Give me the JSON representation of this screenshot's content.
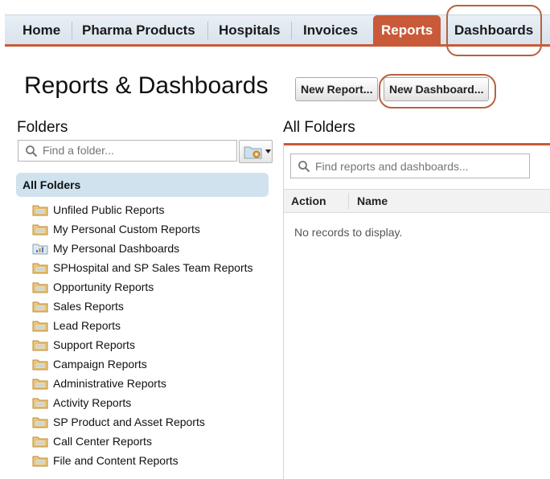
{
  "tabs": [
    {
      "label": "Home",
      "active": false
    },
    {
      "label": "Pharma Products",
      "active": false
    },
    {
      "label": "Hospitals",
      "active": false
    },
    {
      "label": "Invoices",
      "active": false
    },
    {
      "label": "Reports",
      "active": true
    },
    {
      "label": "Dashboards",
      "active": false,
      "circled": true
    }
  ],
  "page": {
    "title": "Reports & Dashboards",
    "new_report_button": "New Report...",
    "new_dashboard_button": "New Dashboard..."
  },
  "folders_panel": {
    "heading": "Folders",
    "search_placeholder": "Find a folder...",
    "search_value": "",
    "all_folders_label": "All Folders",
    "folders": [
      {
        "label": "Unfiled Public Reports",
        "icon": "report-folder-icon"
      },
      {
        "label": "My Personal Custom Reports",
        "icon": "report-folder-icon"
      },
      {
        "label": "My Personal Dashboards",
        "icon": "dashboard-folder-icon"
      },
      {
        "label": "SPHospital and SP Sales Team Reports",
        "icon": "report-folder-icon"
      },
      {
        "label": "Opportunity Reports",
        "icon": "report-folder-icon"
      },
      {
        "label": "Sales Reports",
        "icon": "report-folder-icon"
      },
      {
        "label": "Lead Reports",
        "icon": "report-folder-icon"
      },
      {
        "label": "Support Reports",
        "icon": "report-folder-icon"
      },
      {
        "label": "Campaign Reports",
        "icon": "report-folder-icon"
      },
      {
        "label": "Administrative Reports",
        "icon": "report-folder-icon"
      },
      {
        "label": "Activity Reports",
        "icon": "report-folder-icon"
      },
      {
        "label": "SP Product and Asset Reports",
        "icon": "report-folder-icon"
      },
      {
        "label": "Call Center Reports",
        "icon": "report-folder-icon"
      },
      {
        "label": "File and Content Reports",
        "icon": "report-folder-icon"
      }
    ]
  },
  "content_panel": {
    "heading": "All Folders",
    "search_placeholder": "Find reports and dashboards...",
    "search_value": "",
    "columns": [
      "Action",
      "Name"
    ],
    "empty_message": "No records to display."
  },
  "colors": {
    "accent": "#c85a3a",
    "tab_bar": "#dfe7ee",
    "selected_folder_bg": "#cfe2ee",
    "annotation_ring": "#b8613f"
  }
}
